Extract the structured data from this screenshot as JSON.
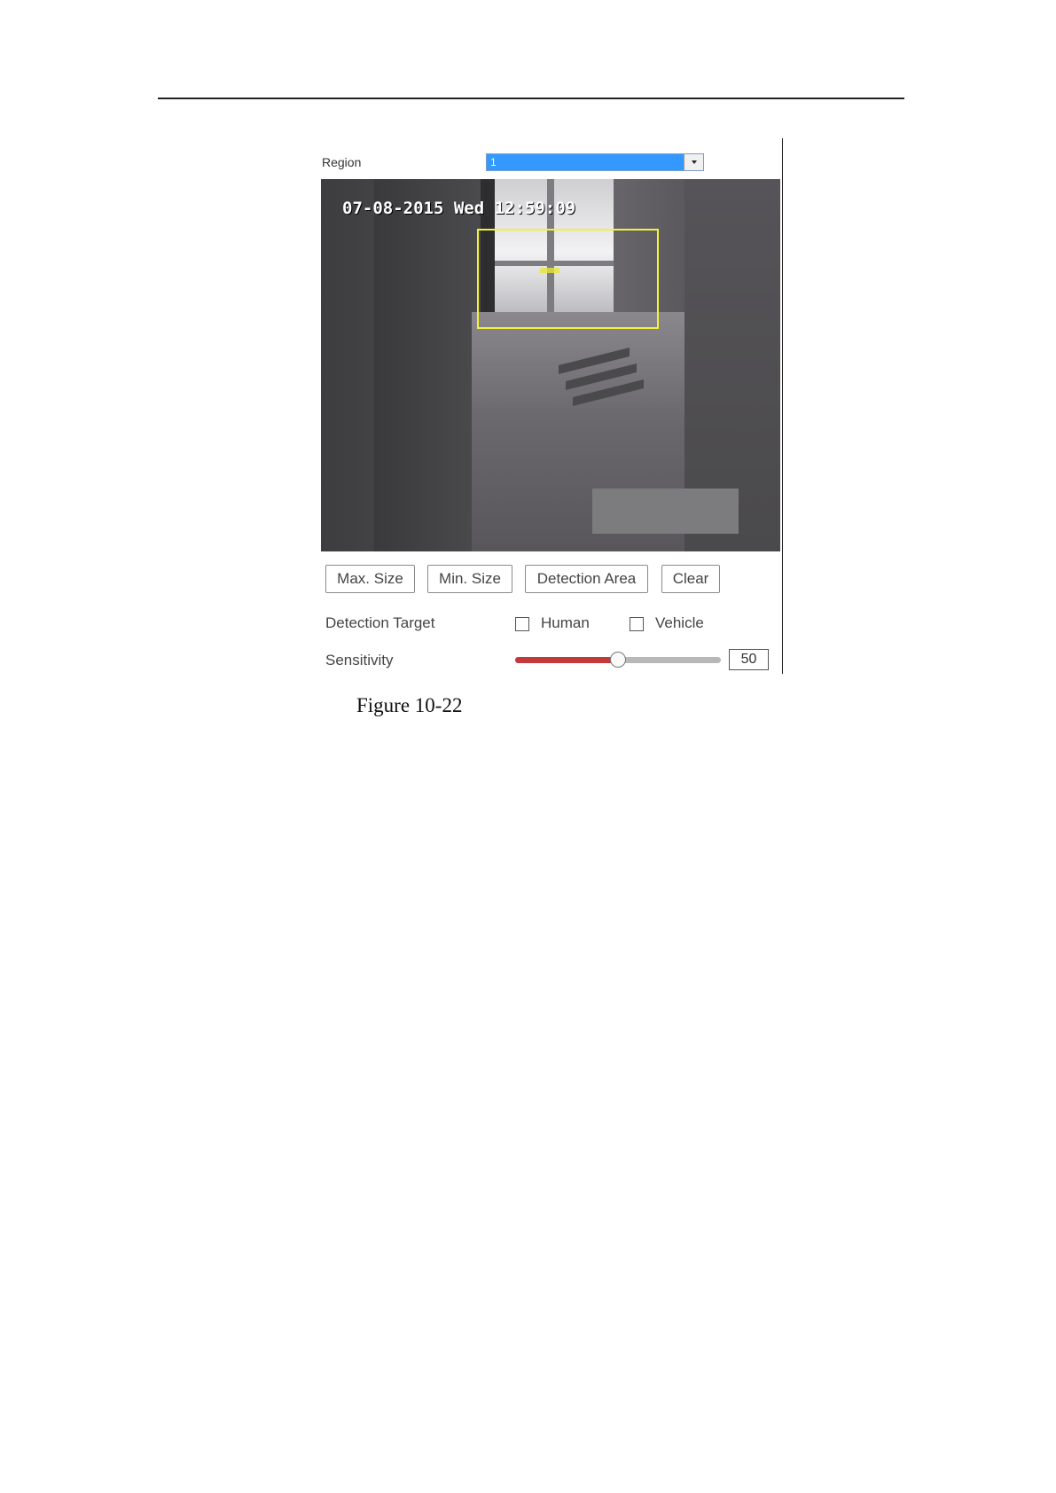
{
  "region": {
    "label": "Region",
    "selected": "1"
  },
  "video": {
    "osd_timestamp": "07-08-2015 Wed 12:59:09"
  },
  "buttons": {
    "max_size": "Max. Size",
    "min_size": "Min. Size",
    "detection_area": "Detection Area",
    "clear": "Clear"
  },
  "detection_target": {
    "label": "Detection Target",
    "options": [
      {
        "label": "Human",
        "checked": false
      },
      {
        "label": "Vehicle",
        "checked": false
      }
    ]
  },
  "sensitivity": {
    "label": "Sensitivity",
    "value": "50",
    "max": 100,
    "fill_color": "#c23a3a"
  },
  "caption": "Figure 10-22"
}
